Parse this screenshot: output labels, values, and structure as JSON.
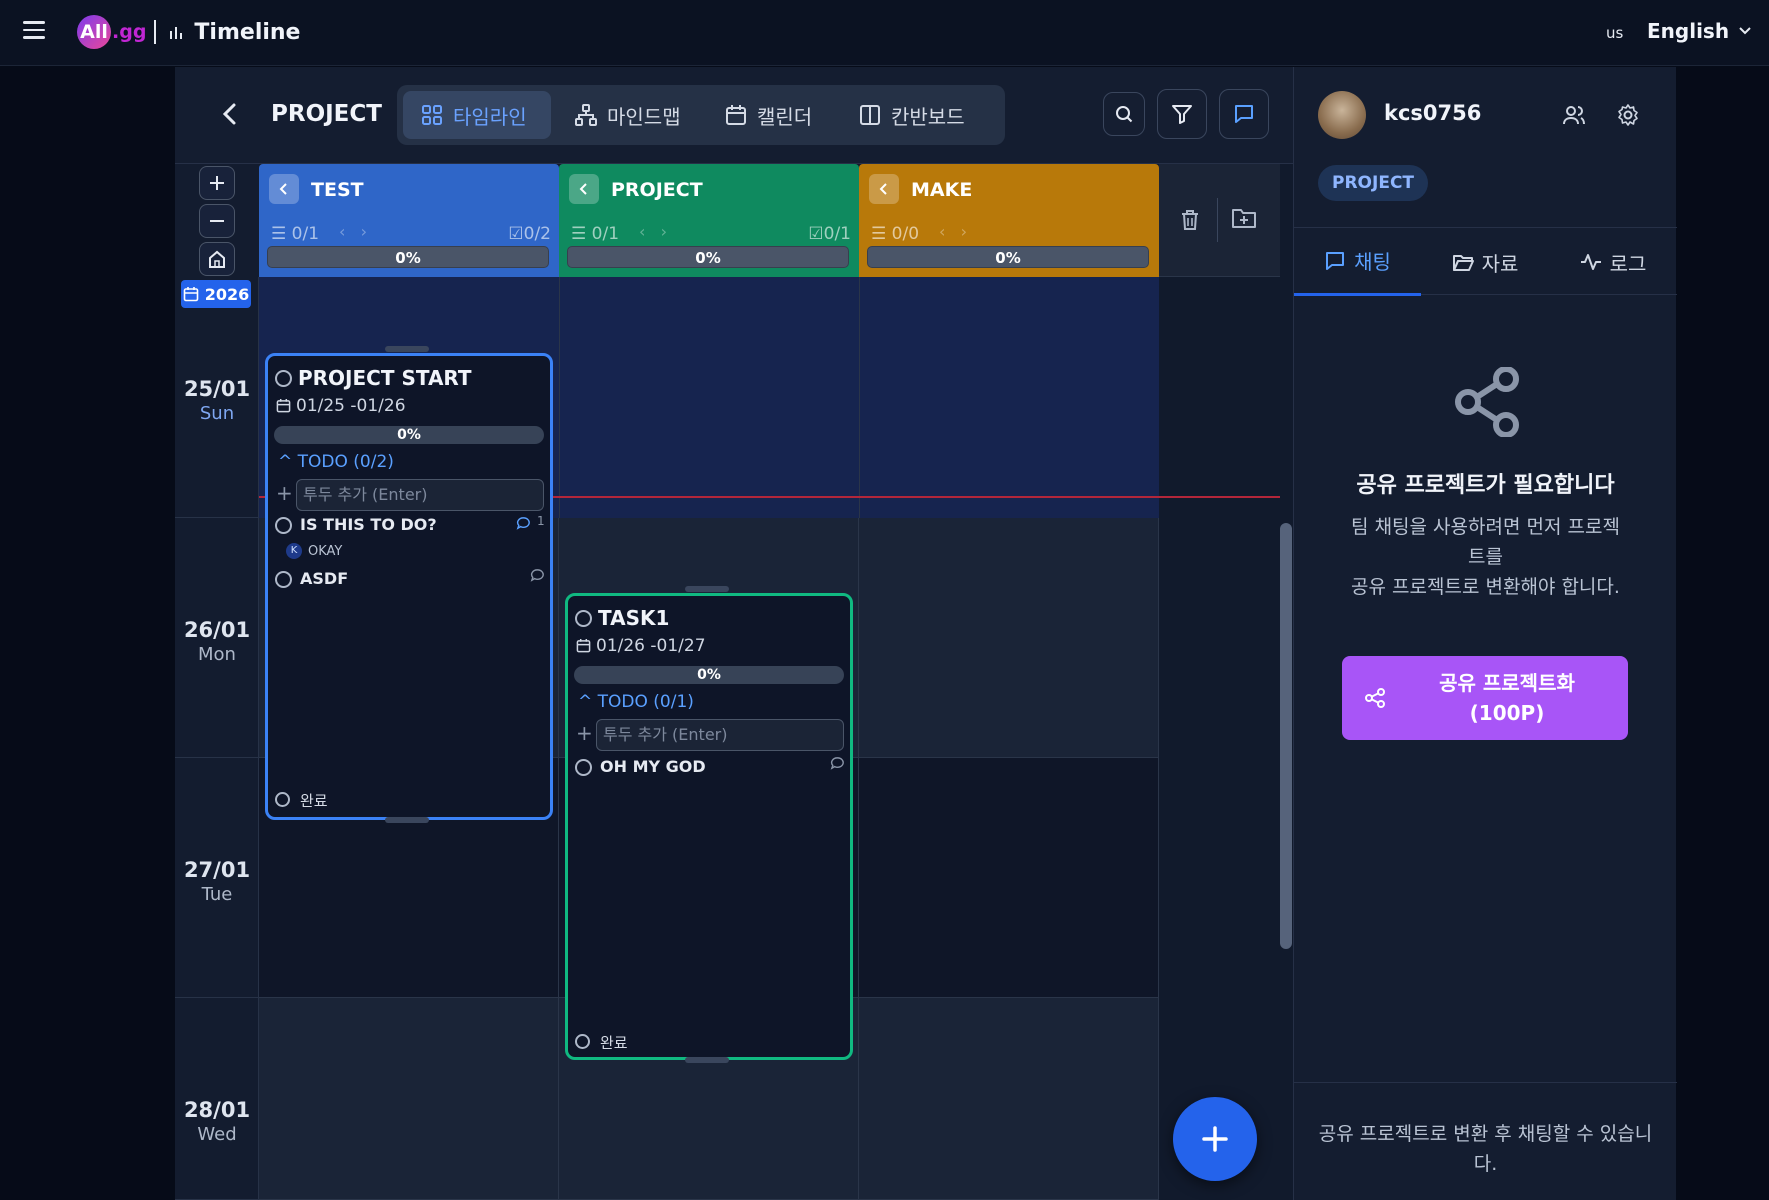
{
  "topbar": {
    "brand": "All",
    "brand_suffix": ".gg",
    "title": "Timeline",
    "locale_code": "us",
    "language": "English"
  },
  "toolbar": {
    "project_title": "PROJECT",
    "views": [
      "타임라인",
      "마인드맵",
      "캘린더",
      "칸반보드"
    ],
    "active_view": "타임라인"
  },
  "year": "2026",
  "days": [
    {
      "date": "25/01",
      "dow": "Sun"
    },
    {
      "date": "26/01",
      "dow": "Mon"
    },
    {
      "date": "27/01",
      "dow": "Tue"
    },
    {
      "date": "28/01",
      "dow": "Wed"
    }
  ],
  "lanes": [
    {
      "name": "TEST",
      "color": "#2f66c8",
      "count": "0/1",
      "checks": "0/2",
      "progress": "0%"
    },
    {
      "name": "PROJECT",
      "color": "#0f8a5f",
      "count": "0/1",
      "checks": "0/1",
      "progress": "0%"
    },
    {
      "name": "MAKE",
      "color": "#b8790a",
      "count": "0/0",
      "checks": "",
      "progress": "0%"
    }
  ],
  "tasks": {
    "project_start": {
      "title": "PROJECT START",
      "dates": "01/25 -01/26",
      "progress": "0%",
      "todo_header": "TODO (0/2)",
      "add_placeholder": "투두 추가 (Enter)",
      "items": [
        {
          "label": "IS THIS TO DO?",
          "comments": "1",
          "assignee_initial": "K",
          "assignee_comment": "OKAY"
        },
        {
          "label": "ASDF"
        }
      ],
      "done_label": "완료"
    },
    "task1": {
      "title": "TASK1",
      "dates": "01/26 -01/27",
      "progress": "0%",
      "todo_header": "TODO (0/1)",
      "add_placeholder": "투두 추가 (Enter)",
      "items": [
        {
          "label": "OH MY GOD"
        }
      ],
      "done_label": "완료"
    }
  },
  "right_panel": {
    "username": "kcs0756",
    "project_chip": "PROJECT",
    "tabs": [
      "채팅",
      "자료",
      "로그"
    ],
    "active_tab": "채팅",
    "share_heading": "공유 프로젝트가 필요합니다",
    "share_desc_1": "팀 채팅을 사용하려면 먼저 프로젝트를",
    "share_desc_2": "공유 프로젝트로 변환해야 합니다.",
    "share_button_1": "공유 프로젝트화",
    "share_button_2": "(100P)",
    "footer": "공유 프로젝트로 변환 후 채팅할 수 있습니다."
  },
  "colors": {
    "accent": "#2463eb",
    "share_button": "#a855f7",
    "now_line": "#b3263a"
  }
}
